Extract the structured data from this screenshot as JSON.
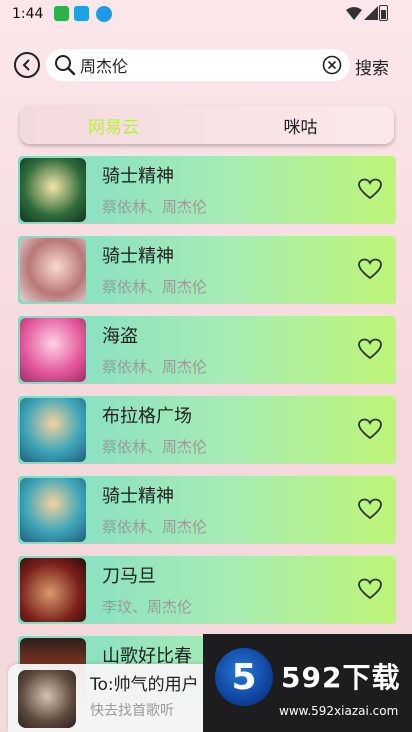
{
  "status_bar": {
    "time": "1:44"
  },
  "search": {
    "query": "周杰伦",
    "button_label": "搜索"
  },
  "tabs": [
    {
      "label": "网易云",
      "active": true
    },
    {
      "label": "咪咕",
      "active": false
    }
  ],
  "songs": [
    {
      "title": "骑士精神",
      "artist": "蔡依林、周杰伦"
    },
    {
      "title": "骑士精神",
      "artist": "蔡依林、周杰伦"
    },
    {
      "title": "海盗",
      "artist": "蔡依林、周杰伦"
    },
    {
      "title": "布拉格广场",
      "artist": "蔡依林、周杰伦"
    },
    {
      "title": "骑士精神",
      "artist": "蔡依林、周杰伦"
    },
    {
      "title": "刀马旦",
      "artist": "李玟、周杰伦"
    },
    {
      "title": "山歌好比春",
      "artist": ""
    }
  ],
  "player": {
    "title": "To:帅气的用户",
    "subtitle": "快去找首歌听"
  },
  "watermark": {
    "badge": "5",
    "name": "592下载",
    "url": "www.592xiazai.com"
  },
  "colors": {
    "active_tab": "#b9ef3c",
    "row_gradient_start": "#7fdcc8",
    "row_gradient_end": "#bdf577"
  },
  "icons": {
    "back": "back-circle-icon",
    "search": "search-icon",
    "clear": "clear-circle-icon",
    "favorite": "heart-outline-icon"
  }
}
